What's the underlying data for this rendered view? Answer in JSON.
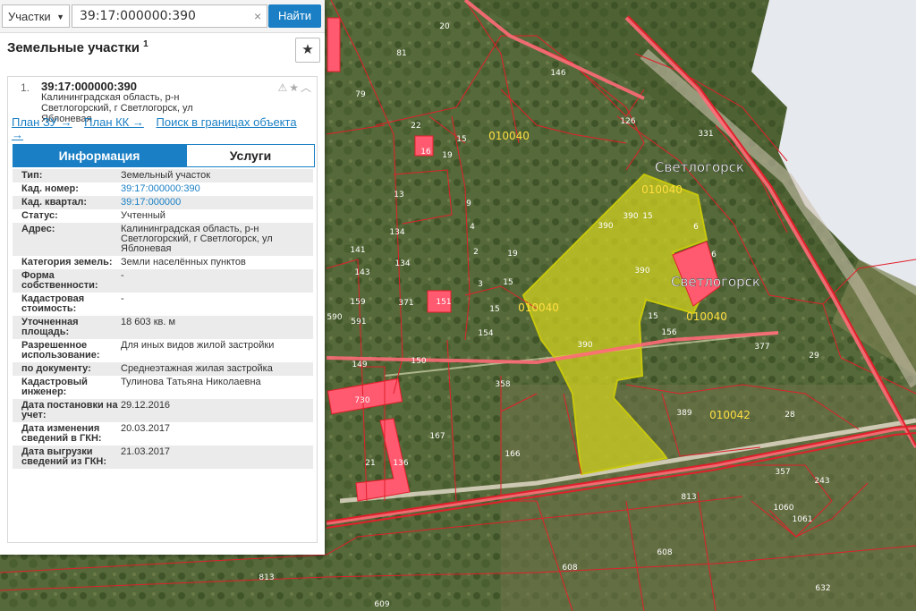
{
  "search": {
    "type_label": "Участки",
    "query": "39:17:000000:390",
    "clear": "×",
    "button": "Найти"
  },
  "panel": {
    "title": "Земельные участки",
    "count": "1",
    "item": {
      "index": "1.",
      "cad_number": "39:17:000000:390",
      "address": "Калининградская область, р-н Светлогорский, г Светлогорск, ул Яблоневая",
      "links": [
        "План ЗУ →",
        "План КК →",
        "Поиск в границах объекта →"
      ]
    },
    "tabs": [
      "Информация",
      "Услуги"
    ],
    "rows": [
      {
        "label": "Тип:",
        "value": "Земельный участок"
      },
      {
        "label": "Кад. номер:",
        "value": "39:17:000000:390"
      },
      {
        "label": "Кад. квартал:",
        "value": "39:17:000000"
      },
      {
        "label": "Статус:",
        "value": "Учтенный"
      },
      {
        "label": "Адрес:",
        "value": "Калининградская область, р-н Светлогорский, г Светлогорск, ул Яблоневая"
      },
      {
        "label": "Категория земель:",
        "value": "Земли населённых пунктов"
      },
      {
        "label": "Форма собственности:",
        "value": "-"
      },
      {
        "label": "Кадастровая стоимость:",
        "value": "-"
      },
      {
        "label": "Уточненная площадь:",
        "value": "18 603 кв. м"
      },
      {
        "label": "Разрешенное использование:",
        "value": "Для иных видов жилой застройки"
      },
      {
        "label": "по документу:",
        "value": "Среднеэтажная жилая застройка"
      },
      {
        "label": "Кадастровый инженер:",
        "value": "Тулинова Татьяна Николаевна"
      },
      {
        "label": "Дата постановки на учет:",
        "value": "29.12.2016"
      },
      {
        "label": "Дата изменения сведений в ГКН:",
        "value": "20.03.2017"
      },
      {
        "label": "Дата выгрузки сведений из ГКН:",
        "value": "21.03.2017"
      }
    ]
  },
  "map": {
    "town_labels": [
      "Светлогорск",
      "Светлогорск"
    ],
    "quarter_labels": [
      "010040",
      "010040",
      "010040",
      "010040",
      "010042"
    ],
    "parcel_labels": [
      "20",
      "81",
      "79",
      "146",
      "126",
      "15",
      "19",
      "16",
      "22",
      "331",
      "9",
      "4",
      "2",
      "13",
      "134",
      "141",
      "143",
      "134",
      "159",
      "3",
      "371",
      "151",
      "15",
      "15",
      "19",
      "154",
      "590",
      "591",
      "149",
      "150",
      "390",
      "390",
      "390",
      "15",
      "390",
      "156",
      "6",
      "6",
      "15",
      "377",
      "29",
      "358",
      "389",
      "28",
      "730",
      "167",
      "166",
      "21",
      "136",
      "813",
      "357",
      "243",
      "1060",
      "1061",
      "608",
      "608",
      "813",
      "632",
      "609"
    ],
    "colors": {
      "selected": "#d4d41e",
      "border": "#e0202a",
      "highlight": "#ff5a70"
    }
  }
}
